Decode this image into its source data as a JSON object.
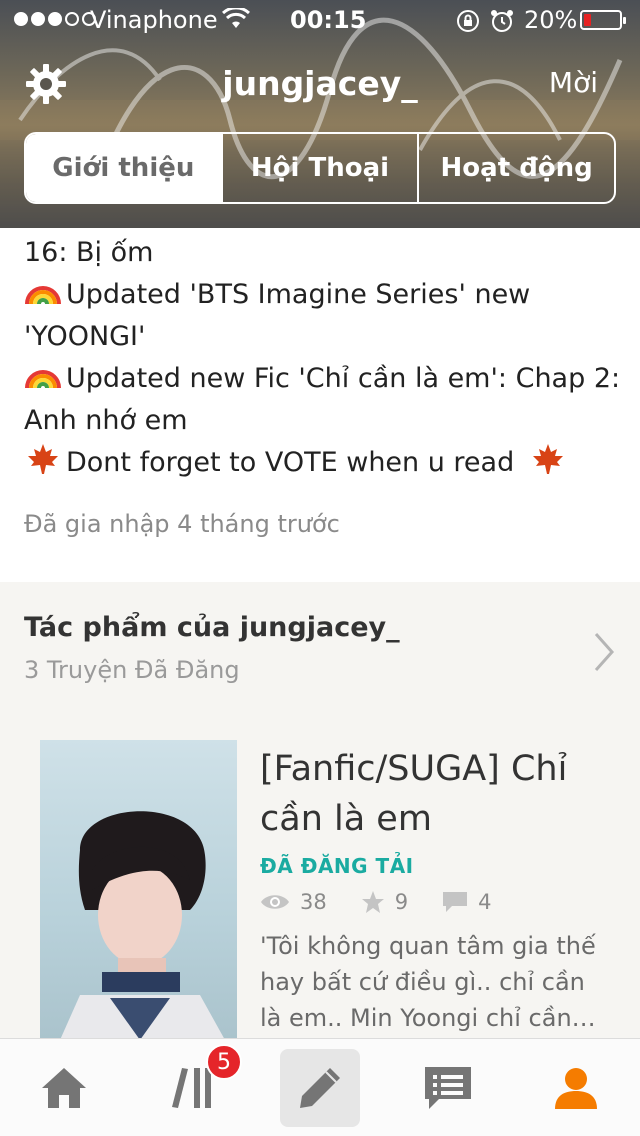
{
  "status_bar": {
    "carrier": "Vinaphone",
    "time": "00:15",
    "battery_percent": "20%",
    "battery_level": 0.2
  },
  "header": {
    "username": "jungjacey_",
    "invite_label": "Mời",
    "tabs": [
      {
        "label": "Giới thiệu",
        "active": true
      },
      {
        "label": "Hội Thoại",
        "active": false
      },
      {
        "label": "Hoạt động",
        "active": false
      }
    ]
  },
  "about": {
    "lines": [
      {
        "emoji": "",
        "text": "16: Bị ốm"
      },
      {
        "emoji": "rainbow-icon",
        "text": "Updated 'BTS Imagine Series' new"
      },
      {
        "emoji": "",
        "text": "'YOONGI'"
      },
      {
        "emoji": "rainbow-icon",
        "text": "Updated new Fic 'Chỉ cần là em': Chap 2:"
      },
      {
        "emoji": "",
        "text": "Anh nhớ em"
      },
      {
        "emoji": "maple-leaf-icon",
        "text": "Dont forget to VOTE when u read"
      }
    ],
    "joined": "Đã gia nhập 4 tháng trước"
  },
  "works": {
    "title": "Tác phẩm của jungjacey_",
    "count": "3 Truyện Đã Đăng",
    "story": {
      "title_line1": "[Fanfic/SUGA] Chỉ",
      "title_line2": "cần là em",
      "status": "ĐÃ ĐĂNG TẢI",
      "views": "38",
      "votes": "9",
      "comments": "4",
      "desc_line1": "'Tôi không quan tâm gia thế",
      "desc_line2": "hay bất cứ điều gì.. chỉ cần",
      "desc_line3": "là em.. Min Yoongi chỉ cần…"
    }
  },
  "bottom_nav": {
    "library_badge": "5",
    "accent_color": "#f57c00",
    "icon_color": "#757575"
  }
}
